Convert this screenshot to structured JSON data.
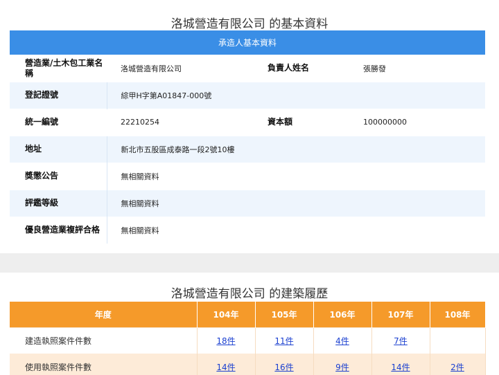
{
  "company_card": {
    "title": "洛城營造有限公司 的基本資料",
    "header": "承造人基本資料",
    "rows": [
      {
        "label": "營造業/土木包工業名稱",
        "value": "洛城營造有限公司",
        "label2": "負責人姓名",
        "value2": "張勝發"
      },
      {
        "label": "登記證號",
        "value": "綜甲H字第A01847-000號"
      },
      {
        "label": "統一編號",
        "value": "22210254",
        "label2": "資本額",
        "value2": "100000000"
      },
      {
        "label": "地址",
        "value": "新北市五股區成泰路一段2號10樓"
      },
      {
        "label": "獎懲公告",
        "value": "無相關資料"
      },
      {
        "label": "評鑑等級",
        "value": "無相關資料"
      },
      {
        "label": "優良營造業複評合格",
        "value": "無相關資料"
      }
    ]
  },
  "history_card": {
    "title": "洛城營造有限公司 的建築履歷",
    "header": {
      "year_label": "年度",
      "years": [
        "104年",
        "105年",
        "106年",
        "107年",
        "108年"
      ]
    },
    "rows": [
      {
        "label": "建造執照案件件數",
        "counts": [
          "18件",
          "11件",
          "4件",
          "7件",
          ""
        ]
      },
      {
        "label": "使用執照案件件數",
        "counts": [
          "14件",
          "16件",
          "9件",
          "14件",
          "2件"
        ]
      }
    ]
  },
  "colors": {
    "info_header": "#3a8ee6",
    "history_header": "#f59a2a",
    "link": "#1a3fd0"
  }
}
